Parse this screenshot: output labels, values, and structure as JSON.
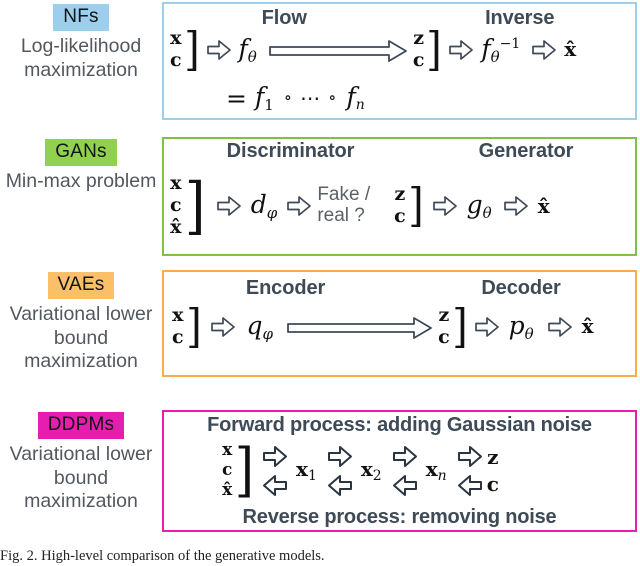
{
  "figure": {
    "caption": "Fig. 2. High-level comparison of the generative models."
  },
  "rows": [
    {
      "key": "nfs",
      "badge": "NFs",
      "badge_color": "#9DCEEC",
      "panel_border_color": "#9DCEEC",
      "objective": "Log-likelihood maximization",
      "head_left": "Flow",
      "head_right": "Inverse",
      "input_stack": [
        "x",
        "c"
      ],
      "latent_stack": [
        "z",
        "c"
      ],
      "left_fn": "f",
      "left_fn_sub": "θ",
      "composition": "= f₁ ∘ ⋯ ∘ fₙ",
      "comp_eq": "=",
      "comp_f1": "f",
      "comp_f1_sub": "1",
      "comp_circ": "∘",
      "comp_dots": "⋯",
      "comp_circ2": "∘",
      "comp_fn": "f",
      "comp_fn_sub": "n",
      "right_fn": "f",
      "right_fn_sub": "θ",
      "right_fn_sup": "−1",
      "output": "x̂"
    },
    {
      "key": "gans",
      "badge": "GANs",
      "badge_color": "#92D14F",
      "panel_border_color": "#7DC242",
      "objective": "Min-max problem",
      "head_left": "Discriminator",
      "head_right": "Generator",
      "input_stack": [
        "x",
        "c",
        "x̂"
      ],
      "latent_stack": [
        "z",
        "c"
      ],
      "left_fn": "d",
      "left_fn_sub": "φ",
      "verdict_line1": "Fake /",
      "verdict_line2": "real ?",
      "right_fn": "g",
      "right_fn_sub": "θ",
      "output": "x̂"
    },
    {
      "key": "vaes",
      "badge": "VAEs",
      "badge_color": "#FBBF68",
      "panel_border_color": "#F5AE49",
      "objective": "Variational lower bound maximization",
      "head_left": "Encoder",
      "head_right": "Decoder",
      "input_stack": [
        "x",
        "c"
      ],
      "latent_stack": [
        "z",
        "c"
      ],
      "left_fn": "q",
      "left_fn_sub": "φ",
      "right_fn": "p",
      "right_fn_sub": "θ",
      "output": "x̂"
    },
    {
      "key": "ddpms",
      "badge": "DDPMs",
      "badge_color": "#E51EB0",
      "panel_border_color": "#E51EB0",
      "objective": "Variational lower bound maximization",
      "forward_title": "Forward process: adding Gaussian noise",
      "reverse_title": "Reverse process: removing noise",
      "input_stack": [
        "x",
        "c",
        "x̂"
      ],
      "latent_stack": [
        "z",
        "c"
      ],
      "steps": [
        {
          "base": "x",
          "sub": "1"
        },
        {
          "base": "x",
          "sub": "2"
        },
        {
          "base": "x",
          "sub": "n"
        }
      ]
    }
  ],
  "icons": {
    "arrow_right": "block-arrow-right-icon",
    "arrow_left": "block-arrow-left-icon",
    "long_arrow_right": "long-block-arrow-right-icon"
  }
}
